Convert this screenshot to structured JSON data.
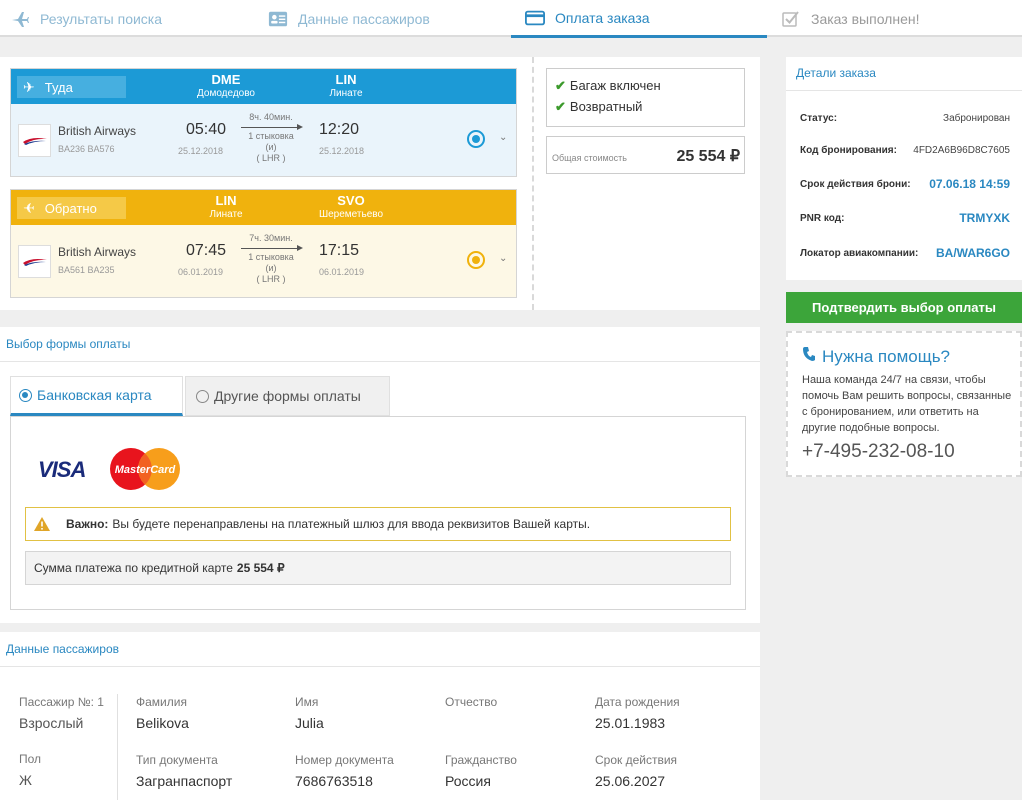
{
  "steps": [
    {
      "label": "Результаты поиска",
      "icon": "plane-icon",
      "state": "pending"
    },
    {
      "label": "Данные пассажиров",
      "icon": "id-card-icon",
      "state": "pending"
    },
    {
      "label": "Оплата заказа",
      "icon": "credit-card-icon",
      "state": "active"
    },
    {
      "label": "Заказ выполнен!",
      "icon": "checkbox-icon",
      "state": "done"
    }
  ],
  "outbound": {
    "tag": "Туда",
    "color": "#1c9ad6",
    "from_code": "DME",
    "from_city": "Домодедово",
    "to_code": "LIN",
    "to_city": "Линате",
    "airline": "British Airways",
    "flights": "BA236  BA576",
    "dep_time": "05:40",
    "dep_date": "25.12.2018",
    "duration": "8ч. 40мин.",
    "stops": "1 стыковка",
    "stops_note": "(и)",
    "via": "( LHR )",
    "arr_time": "12:20",
    "arr_date": "25.12.2018"
  },
  "return": {
    "tag": "Обратно",
    "color": "#f0b20d",
    "from_code": "LIN",
    "from_city": "Линате",
    "to_code": "SVO",
    "to_city": "Шереметьево",
    "airline": "British Airways",
    "flights": "BA561  BA235",
    "dep_time": "07:45",
    "dep_date": "06.01.2019",
    "duration": "7ч. 30мин.",
    "stops": "1 стыковка",
    "stops_note": "(и)",
    "via": "( LHR )",
    "arr_time": "17:15",
    "arr_date": "06.01.2019"
  },
  "features": {
    "baggage": "Багаж включен",
    "refundable": "Возвратный"
  },
  "total": {
    "label": "Общая стоимость",
    "value": "25 554 ₽"
  },
  "order": {
    "title": "Детали заказа",
    "rows": [
      {
        "label": "Статус:",
        "value": "Забронирован"
      },
      {
        "label": "Код бронирования:",
        "value": "4FD2A6B96D8C7605"
      },
      {
        "label": "Срок действия брони:",
        "value": "07.06.18 14:59"
      },
      {
        "label": "PNR код:",
        "value": "TRMYXK"
      },
      {
        "label": "Локатор авиакомпании:",
        "value": "BA/WAR6GO"
      }
    ]
  },
  "confirm_label": "Подтвердить выбор оплаты",
  "help": {
    "title": "Нужна помощь?",
    "body": "Наша команда 24/7 на связи, чтобы помочь Вам решить вопросы, связанные с бронированием, или ответить на другие подобные вопросы.",
    "phone": "+7-495-232-08-10"
  },
  "payment": {
    "title": "Выбор формы оплаты",
    "tab_card": "Банковская карта",
    "tab_other": "Другие формы оплаты",
    "visa": "VISA",
    "mastercard": "MasterCard",
    "warning_bold": "Важно:",
    "warning_text": "Вы будете перенаправлены на платежный шлюз для ввода реквизитов Вашей карты.",
    "sum_label": "Сумма платежа по кредитной карте",
    "sum_value": "25 554 ₽"
  },
  "passengers": {
    "title": "Данные пассажиров",
    "passenger_label": "Пассажир №: 1",
    "type": "Взрослый",
    "sex_label": "Пол",
    "sex": "Ж",
    "surname_label": "Фамилия",
    "surname": "Belikova",
    "name_label": "Имя",
    "name": "Julia",
    "patronymic_label": "Отчество",
    "patronymic": "",
    "birth_label": "Дата рождения",
    "birth": "25.01.1983",
    "doc_type_label": "Тип документа",
    "doc_type": "Загранпаспорт",
    "doc_num_label": "Номер документа",
    "doc_num": "7686763518",
    "citizenship_label": "Гражданство",
    "citizenship": "Россия",
    "expiry_label": "Срок действия",
    "expiry": "25.06.2027"
  }
}
